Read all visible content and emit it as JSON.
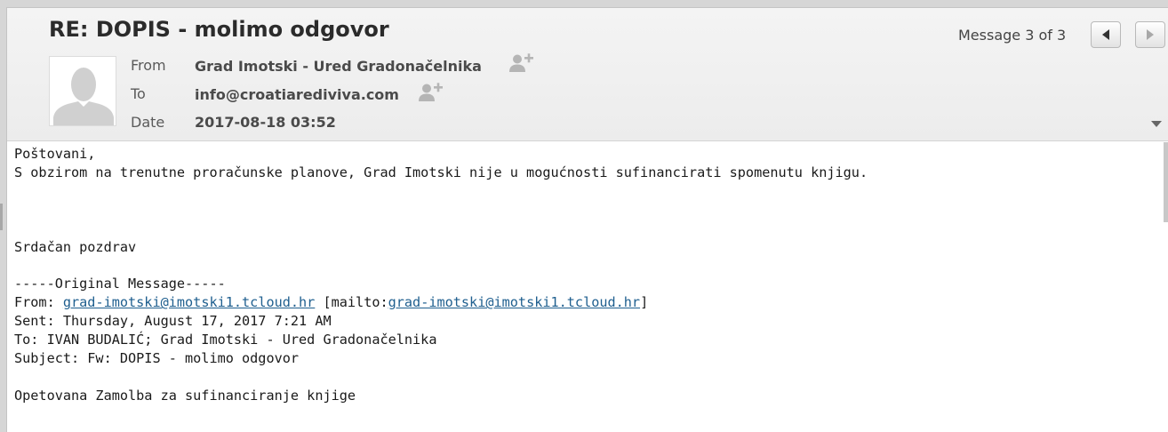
{
  "header": {
    "subject": "RE: DOPIS - molimo odgovor",
    "message_counter": "Message 3 of 3",
    "fields": [
      {
        "label": "From",
        "value": "Grad Imotski - Ured Gradonačelnika"
      },
      {
        "label": "To",
        "value": "info@croatiarediviva.com"
      },
      {
        "label": "Date",
        "value": "2017-08-18 03:52"
      }
    ],
    "icons": {
      "avatar": "person-silhouette-icon",
      "add_contact": "add-person-icon",
      "prev": "chevron-left-icon",
      "next": "chevron-right-icon",
      "expand": "caret-down-icon"
    }
  },
  "body": {
    "greeting": "Poštovani,",
    "paragraph": "S obzirom na trenutne proračunske planove, Grad Imotski nije u mogućnosti sufinancirati spomenutu knjigu.",
    "closing": "Srdačan pozdrav",
    "original": {
      "separator": "-----Original Message-----",
      "from_prefix": "From: ",
      "from_email": "grad-imotski@imotski1.tcloud.hr",
      "mailto_prefix": " [mailto:",
      "mailto_email": "grad-imotski@imotski1.tcloud.hr",
      "mailto_suffix": "]",
      "sent": "Sent: Thursday, August 17, 2017 7:21 AM",
      "to": "To: IVAN BUDALIĆ; Grad Imotski - Ured Gradonačelnika",
      "subject": "Subject: Fw: DOPIS - molimo odgovor",
      "content": "Opetovana Zamolba za sufinanciranje knjige"
    }
  },
  "colors": {
    "link": "#1f5f8f",
    "header_bg": "#efefef",
    "subject_text": "#2b2b2b"
  }
}
